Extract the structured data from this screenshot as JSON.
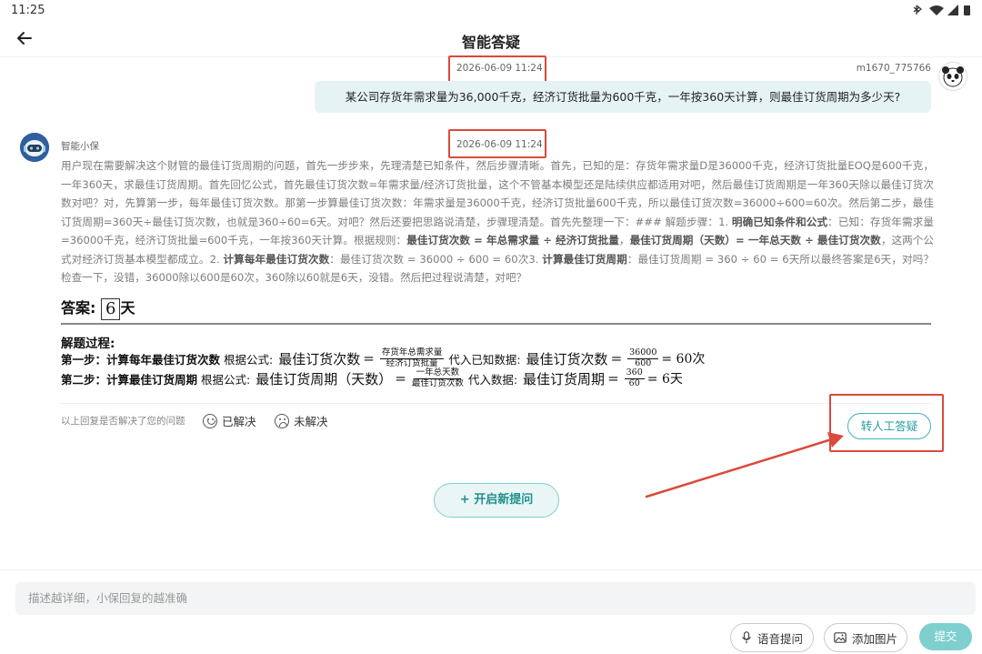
{
  "status_bar": {
    "time": "11:25",
    "icons": "✱ ▾ ◢ ▮"
  },
  "header": {
    "title": "智能答疑"
  },
  "user_message": {
    "timestamp": "2026-06-09 11:24",
    "username": "m1670_775766",
    "text": "某公司存货年需求量为36,000千克，经济订货批量为600千克，一年按360天计算，则最佳订货周期为多少天?"
  },
  "bot_message": {
    "name": "智能小保",
    "timestamp": "2026-06-09 11:24",
    "thinking": [
      {
        "t": "用户现在需要解决这个财管的最佳订货周期的问题，首先一步步来，先理清楚已知条件，然后步骤清晰。首先，已知的是：存货年需求量D是36000千克，经济订货批量EOQ是600千克，一年360天，求最佳订货周期。首先回忆公式，首先最佳订货次数=年需求量/经济订货批量，这个不管基本模型还是陆续供应都适用对吧，然后最佳订货周期是一年360天除以最佳订货次数对吧？对，先算第一步，每年最佳订货次数。那第一步算最佳订货次数：年需求量是36000千克，经济订货批量600千克，所以最佳订货次数=36000÷600=60次。然后第二步，最佳订货周期=360天÷最佳订货次数，也就是360÷60=6天。对吧？然后还要把思路说清楚，步骤理清楚。首先先整理一下：### 解题步骤：1. ",
        "b": false
      },
      {
        "t": "明确已知条件和公式",
        "b": true
      },
      {
        "t": "：已知：存货年需求量=36000千克，经济订货批量=600千克，一年按360天计算。根据规则：",
        "b": false
      },
      {
        "t": "最佳订货次数 = 年总需求量 ÷ 经济订货批量",
        "b": true
      },
      {
        "t": "，",
        "b": false
      },
      {
        "t": "最佳订货周期（天数）= 一年总天数 ÷ 最佳订货次数",
        "b": true
      },
      {
        "t": "，这两个公式对经济订货基本模型都成立。2. ",
        "b": false
      },
      {
        "t": "计算每年最佳订货次数",
        "b": true
      },
      {
        "t": "：最佳订货次数 = 36000 ÷ 600 = 60次3. ",
        "b": false
      },
      {
        "t": "计算最佳订货周期",
        "b": true
      },
      {
        "t": "：最佳订货周期 = 360 ÷ 60 = 6天所以最终答案是6天，对吗？检查一下，没错，36000除以600是60次，360除以60就是6天，没错。然后把过程说清楚，对吧？",
        "b": false
      }
    ],
    "answer_label": "答案:",
    "answer_value": "6",
    "answer_unit": "天",
    "process_title": "解题过程:",
    "step1": {
      "label": "第一步：计算每年最佳订货次数",
      "formula_intro": "根据公式:",
      "lhs": "最佳订货次数",
      "eq": "=",
      "frac_num": "存货年总需求量",
      "frac_den": "经济订货批量",
      "sub_intro": "代入已知数据:",
      "lhs2": "最佳订货次数",
      "frac2_num": "36000",
      "frac2_den": "600",
      "result": "= 60次"
    },
    "step2": {
      "label": "第二步：计算最佳订货周期",
      "formula_intro": "根据公式:",
      "lhs": "最佳订货周期（天数）",
      "eq": "=",
      "frac_num": "一年总天数",
      "frac_den": "最佳订货次数",
      "sub_intro": "代入数据:",
      "lhs2": "最佳订货周期",
      "frac2_num": "360",
      "frac2_den": "60",
      "result": "= 6天"
    },
    "feedback_question": "以上回复是否解决了您的问题",
    "resolved_label": "已解决",
    "unresolved_label": "未解决",
    "human_button": "转人工答疑"
  },
  "new_question_button": "+ 开启新提问",
  "input": {
    "placeholder": "描述越详细，小保回复的越准确",
    "value": ""
  },
  "toolbar": {
    "voice_label": "语音提问",
    "image_label": "添加图片",
    "submit_label": "提交"
  },
  "colors": {
    "accent": "#3fb3b3",
    "highlight": "#d94a3a",
    "user_bubble": "#e6f3f4"
  }
}
